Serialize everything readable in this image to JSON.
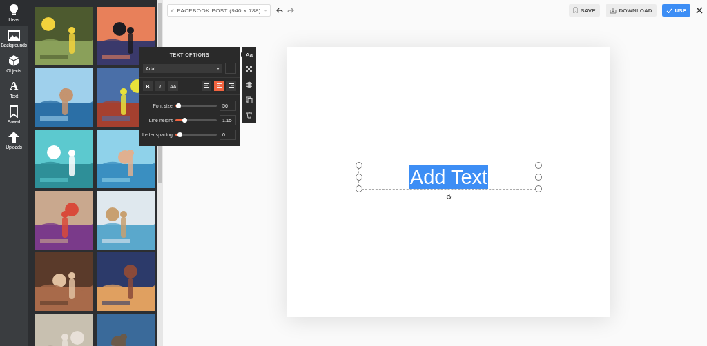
{
  "nav": [
    {
      "label": "Ideas",
      "selected": true
    },
    {
      "label": "Backgrounds",
      "selected": false
    },
    {
      "label": "Objects",
      "selected": false
    },
    {
      "label": "Text",
      "glyph": "A",
      "selected": false
    },
    {
      "label": "Saved",
      "selected": false
    },
    {
      "label": "Uploads",
      "selected": false
    }
  ],
  "toolbar": {
    "size_dropdown": "FACEBOOK POST (940 × 788)",
    "save": "SAVE",
    "download": "DOWNLOAD",
    "use": "USE"
  },
  "text_options": {
    "title": "TEXT OPTIONS",
    "font": "Arial",
    "styles": [
      "B",
      "I",
      "AA"
    ],
    "align": [
      {
        "kind": "left",
        "selected": false
      },
      {
        "kind": "center",
        "selected": true
      },
      {
        "kind": "right",
        "selected": false
      }
    ],
    "sliders": [
      {
        "label": "Font size",
        "level": 0.07,
        "reading": "56"
      },
      {
        "label": "Line height",
        "level": 0.22,
        "reading": "1.15"
      },
      {
        "label": "Letter spacing",
        "level": 0.1,
        "reading": "0"
      }
    ]
  },
  "side_tools": {
    "font_glyph": "Aa"
  },
  "canvas": {
    "text": "Add Text",
    "selected": true
  }
}
